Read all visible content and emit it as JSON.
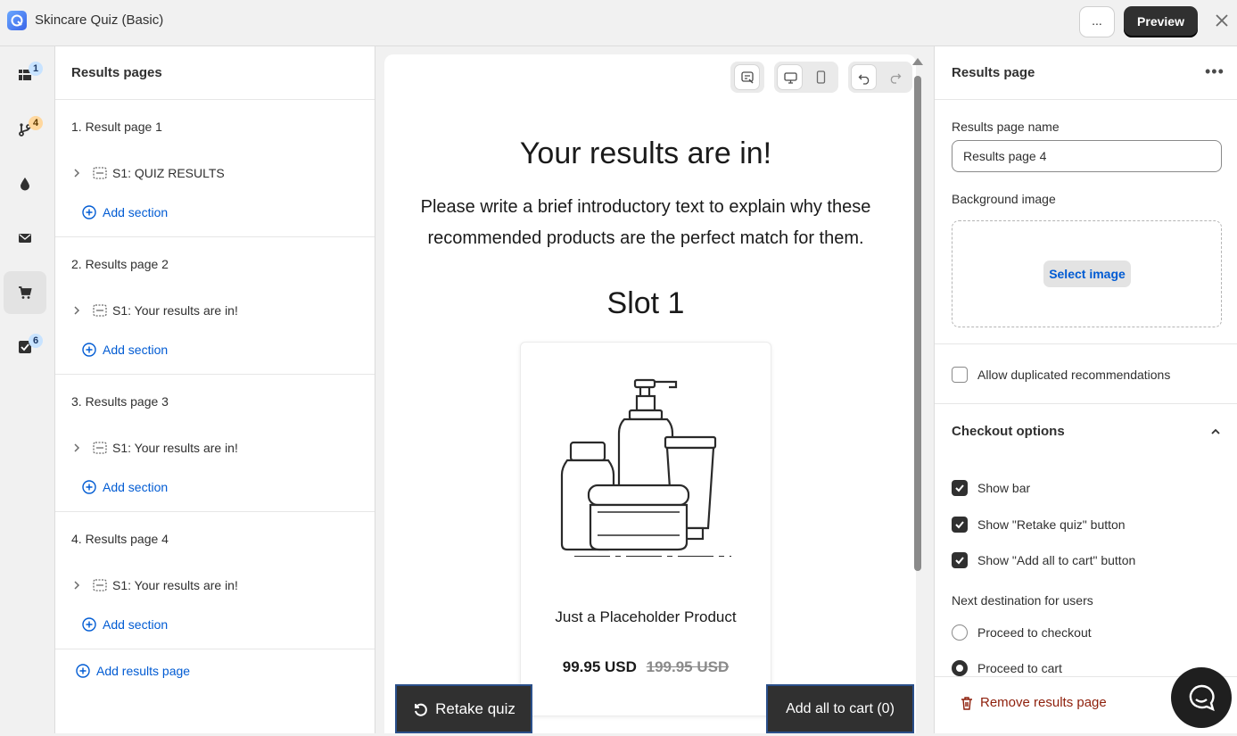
{
  "app": {
    "title": "Skincare Quiz (Basic)",
    "more_label": "...",
    "preview_label": "Preview"
  },
  "rail": {
    "items": [
      {
        "name": "overview-icon",
        "badge": "1"
      },
      {
        "name": "branching-icon",
        "badge": "4"
      },
      {
        "name": "droplet-icon",
        "badge": ""
      },
      {
        "name": "mail-icon",
        "badge": ""
      },
      {
        "name": "cart-icon",
        "badge": "",
        "active": true
      },
      {
        "name": "checkbox-icon",
        "badge": "6"
      }
    ]
  },
  "left": {
    "title": "Results pages",
    "groups": [
      {
        "title": "1. Result page 1",
        "section": "S1: QUIZ RESULTS",
        "add": "Add section"
      },
      {
        "title": "2. Results page 2",
        "section": "S1: Your results are in!",
        "add": "Add section"
      },
      {
        "title": "3. Results page 3",
        "section": "S1: Your results are in!",
        "add": "Add section"
      },
      {
        "title": "4. Results page 4",
        "section": "S1: Your results are in!",
        "add": "Add section"
      }
    ],
    "add_page": "Add results page"
  },
  "canvas": {
    "heading": "Your results are in!",
    "intro": "Please write a brief introductory text to explain why these recommended products are the perfect match for them.",
    "slot_title": "Slot 1",
    "product": {
      "name": "Just a Placeholder Product",
      "price": "99.95 USD",
      "compare_price": "199.95 USD"
    },
    "retake_label": "Retake quiz",
    "add_all_label": "Add all to cart (0)"
  },
  "right": {
    "title": "Results page",
    "name_label": "Results page name",
    "name_value": "Results page 4",
    "bg_label": "Background image",
    "select_image": "Select image",
    "allow_dup": "Allow duplicated recommendations",
    "checkout_title": "Checkout options",
    "show_bar": "Show bar",
    "show_retake": "Show \"Retake quiz\" button",
    "show_add_all": "Show \"Add all to cart\" button",
    "next_dest_label": "Next destination for users",
    "dest_checkout": "Proceed to checkout",
    "dest_cart": "Proceed to cart",
    "remove": "Remove results page"
  },
  "colors": {
    "accent": "#005bd3",
    "dark": "#303030",
    "danger": "#8e1f0b"
  }
}
